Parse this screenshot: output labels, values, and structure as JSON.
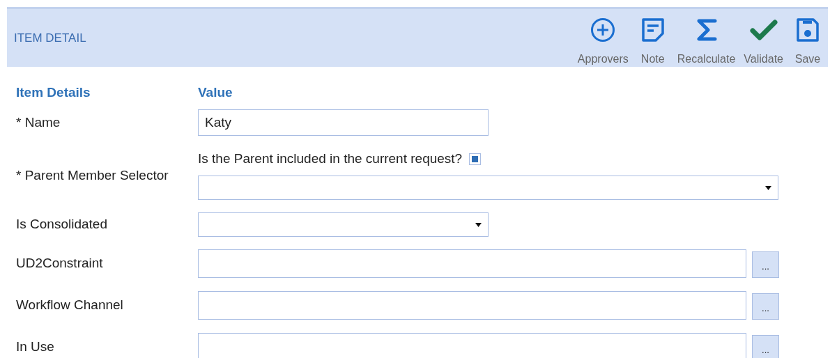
{
  "header": {
    "title": "ITEM DETAIL",
    "actions": [
      {
        "kind": "add",
        "label": "Approvers"
      },
      {
        "kind": "note",
        "label": "Note"
      },
      {
        "kind": "sum",
        "label": "Recalculate"
      },
      {
        "kind": "check",
        "label": "Validate"
      },
      {
        "kind": "save",
        "label": "Save"
      }
    ]
  },
  "form": {
    "columns": [
      "Item Details",
      "Value"
    ],
    "rows": [
      {
        "kind": "text",
        "label": "* Name",
        "value": "Katy"
      },
      {
        "kind": "select_with_check",
        "label": "* Parent Member Selector",
        "check_label": "Is the Parent included in the current request?",
        "checked": true,
        "value": ""
      },
      {
        "kind": "select",
        "label": "Is Consolidated",
        "value": ""
      },
      {
        "kind": "lookup",
        "label": "UD2Constraint",
        "value": "",
        "button": "..."
      },
      {
        "kind": "lookup",
        "label": "Workflow Channel",
        "value": "",
        "button": "..."
      },
      {
        "kind": "lookup",
        "label": "In Use",
        "value": "",
        "button": "..."
      }
    ]
  }
}
